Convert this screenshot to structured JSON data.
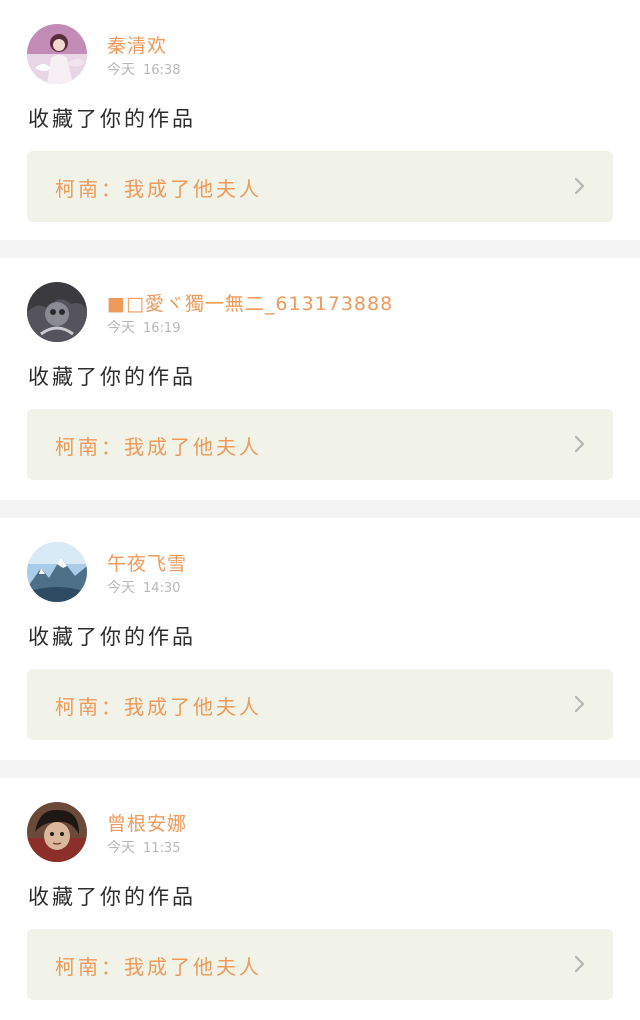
{
  "colors": {
    "accent": "#ee9a5a",
    "muted": "#b8b8b8",
    "text": "#2d2d2d",
    "card_link_bg": "#f1f3e8",
    "page_bg": "#f4f4f4"
  },
  "notifications": [
    {
      "username": "秦清欢",
      "day": "今天",
      "time": "16:38",
      "action": "收藏了你的作品",
      "work_title": "柯南：我成了他夫人",
      "avatar_icon": "avatar-girl-icon",
      "chevron_icon": "chevron-right-icon"
    },
    {
      "username": "■□愛ヾ獨一無二_613173888",
      "day": "今天",
      "time": "16:19",
      "action": "收藏了你的作品",
      "work_title": "柯南：我成了他夫人",
      "avatar_icon": "avatar-dark-icon",
      "chevron_icon": "chevron-right-icon"
    },
    {
      "username": "午夜飞雪",
      "day": "今天",
      "time": "14:30",
      "action": "收藏了你的作品",
      "work_title": "柯南：我成了他夫人",
      "avatar_icon": "avatar-mountain-icon",
      "chevron_icon": "chevron-right-icon"
    },
    {
      "username": "曾根安娜",
      "day": "今天",
      "time": "11:35",
      "action": "收藏了你的作品",
      "work_title": "柯南：我成了他夫人",
      "avatar_icon": "avatar-character-icon",
      "chevron_icon": "chevron-right-icon"
    }
  ]
}
